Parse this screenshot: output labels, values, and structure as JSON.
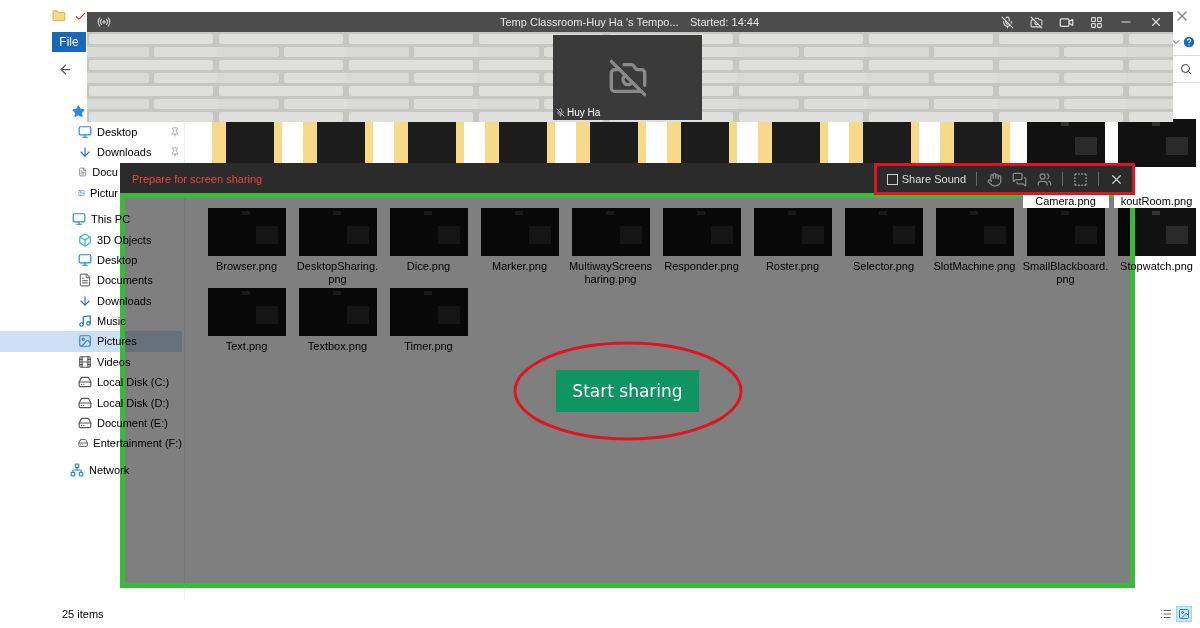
{
  "explorer": {
    "file_tab": "File",
    "quick_access": [
      {
        "label": "Desktop",
        "kind": "desktop",
        "pinned": true
      },
      {
        "label": "Downloads",
        "kind": "download",
        "pinned": true
      },
      {
        "label": "Docu",
        "kind": "document"
      },
      {
        "label": "Pictur",
        "kind": "picture"
      }
    ],
    "this_pc": {
      "label": "This PC",
      "children": [
        {
          "label": "3D Objects",
          "kind": "cube",
          "selected": false
        },
        {
          "label": "Desktop",
          "kind": "desktop",
          "selected": false
        },
        {
          "label": "Documents",
          "kind": "document",
          "selected": false
        },
        {
          "label": "Downloads",
          "kind": "download",
          "selected": false
        },
        {
          "label": "Music",
          "kind": "music",
          "selected": false
        },
        {
          "label": "Pictures",
          "kind": "picture",
          "selected": true
        },
        {
          "label": "Videos",
          "kind": "video",
          "selected": false
        },
        {
          "label": "Local Disk (C:)",
          "kind": "drive",
          "selected": false
        },
        {
          "label": "Local Disk (D:)",
          "kind": "drive",
          "selected": false
        },
        {
          "label": "Document (E:)",
          "kind": "drive",
          "selected": false
        },
        {
          "label": "Entertainment (F:)",
          "kind": "drive",
          "selected": false
        }
      ]
    },
    "network": "Network",
    "top_row": [
      {
        "kind": "folder"
      },
      {
        "kind": "folder"
      },
      {
        "kind": "folder"
      },
      {
        "kind": "folder"
      },
      {
        "kind": "folder"
      },
      {
        "kind": "folder"
      },
      {
        "kind": "folder"
      },
      {
        "kind": "folder"
      },
      {
        "kind": "folder"
      },
      {
        "label": "Camera.png"
      },
      {
        "label": "koutRoom.png"
      }
    ],
    "files": [
      "Browser.png",
      "DesktopSharing.png",
      "Dice.png",
      "Marker.png",
      "MultiwayScreensharing.png",
      "Responder.png",
      "Roster.png",
      "Selector.png",
      "SlotMachine.png",
      "SmallBlackboard.png",
      "Stopwatch.png",
      "Text.png",
      "Textbox.png",
      "Timer.png"
    ],
    "status": "25 items",
    "views": [
      {
        "selected": false
      },
      {
        "selected": true
      }
    ]
  },
  "meeting": {
    "title": "Temp Classroom-Huy Ha 's Tempo...",
    "started": "Started: 14:44",
    "participant": "Huy Ha"
  },
  "share": {
    "heading": "Prepare for screen sharing",
    "share_sound": {
      "label": "Share Sound",
      "checked": false
    },
    "start_button": "Start sharing"
  }
}
